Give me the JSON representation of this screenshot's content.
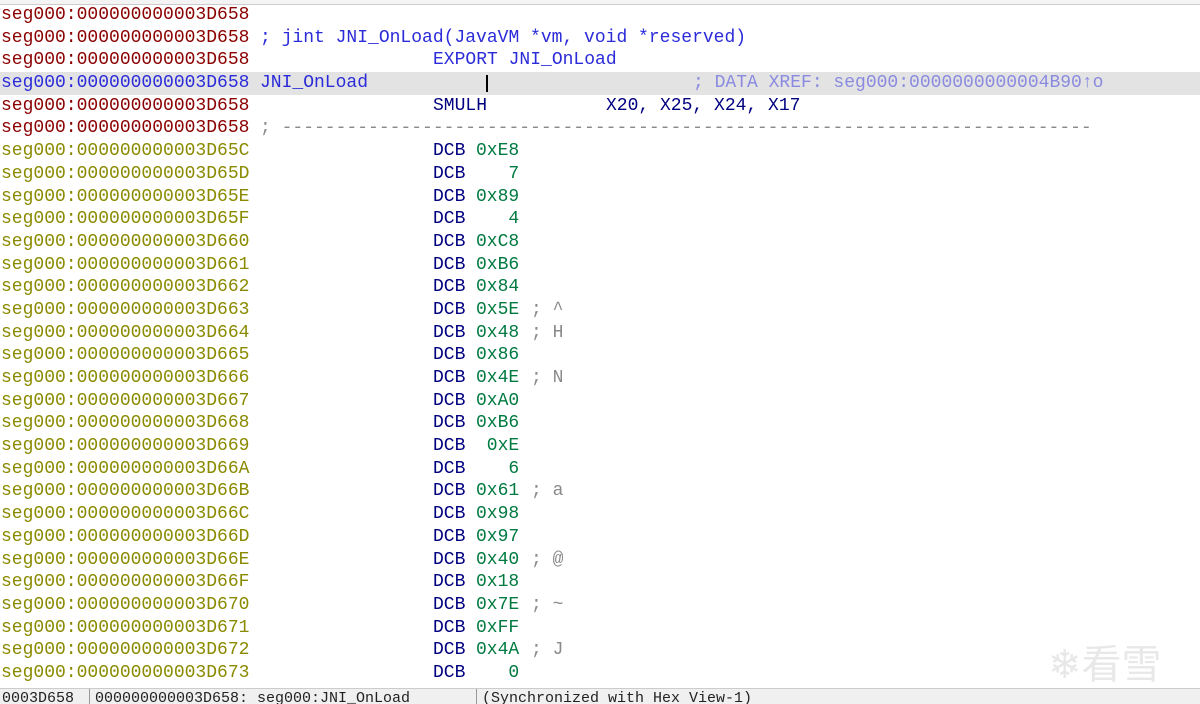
{
  "rows": [
    {
      "addr": "seg000:000000000003D658",
      "kind": "code"
    },
    {
      "addr": "seg000:000000000003D658",
      "kind": "code",
      "comment": "; jint JNI_OnLoad(JavaVM *vm, void *reserved)"
    },
    {
      "addr": "seg000:000000000003D658",
      "kind": "code",
      "mnemonic": "EXPORT JNI_OnLoad"
    },
    {
      "addr": "seg000:000000000003D658",
      "kind": "selected",
      "label": "JNI_OnLoad",
      "xref": "; DATA XREF: seg000:0000000000004B90↑o"
    },
    {
      "addr": "seg000:000000000003D658",
      "kind": "code",
      "mnemonic": "SMULH",
      "operands": "X20, X25, X24, X17"
    },
    {
      "addr": "seg000:000000000003D658",
      "kind": "code",
      "separator": "; ---------------------------------------------------------------------------"
    }
  ],
  "data_rows": [
    {
      "addr": "seg000:000000000003D65C",
      "op": "DCB",
      "val": "0xE8"
    },
    {
      "addr": "seg000:000000000003D65D",
      "op": "DCB",
      "val": "   7"
    },
    {
      "addr": "seg000:000000000003D65E",
      "op": "DCB",
      "val": "0x89"
    },
    {
      "addr": "seg000:000000000003D65F",
      "op": "DCB",
      "val": "   4"
    },
    {
      "addr": "seg000:000000000003D660",
      "op": "DCB",
      "val": "0xC8"
    },
    {
      "addr": "seg000:000000000003D661",
      "op": "DCB",
      "val": "0xB6"
    },
    {
      "addr": "seg000:000000000003D662",
      "op": "DCB",
      "val": "0x84"
    },
    {
      "addr": "seg000:000000000003D663",
      "op": "DCB",
      "val": "0x5E",
      "cmt": "; ^"
    },
    {
      "addr": "seg000:000000000003D664",
      "op": "DCB",
      "val": "0x48",
      "cmt": "; H"
    },
    {
      "addr": "seg000:000000000003D665",
      "op": "DCB",
      "val": "0x86"
    },
    {
      "addr": "seg000:000000000003D666",
      "op": "DCB",
      "val": "0x4E",
      "cmt": "; N"
    },
    {
      "addr": "seg000:000000000003D667",
      "op": "DCB",
      "val": "0xA0"
    },
    {
      "addr": "seg000:000000000003D668",
      "op": "DCB",
      "val": "0xB6"
    },
    {
      "addr": "seg000:000000000003D669",
      "op": "DCB",
      "val": " 0xE"
    },
    {
      "addr": "seg000:000000000003D66A",
      "op": "DCB",
      "val": "   6"
    },
    {
      "addr": "seg000:000000000003D66B",
      "op": "DCB",
      "val": "0x61",
      "cmt": "; a"
    },
    {
      "addr": "seg000:000000000003D66C",
      "op": "DCB",
      "val": "0x98"
    },
    {
      "addr": "seg000:000000000003D66D",
      "op": "DCB",
      "val": "0x97"
    },
    {
      "addr": "seg000:000000000003D66E",
      "op": "DCB",
      "val": "0x40",
      "cmt": "; @"
    },
    {
      "addr": "seg000:000000000003D66F",
      "op": "DCB",
      "val": "0x18"
    },
    {
      "addr": "seg000:000000000003D670",
      "op": "DCB",
      "val": "0x7E",
      "cmt": "; ~"
    },
    {
      "addr": "seg000:000000000003D671",
      "op": "DCB",
      "val": "0xFF"
    },
    {
      "addr": "seg000:000000000003D672",
      "op": "DCB",
      "val": "0x4A",
      "cmt": "; J"
    },
    {
      "addr": "seg000:000000000003D673",
      "op": "DCB",
      "val": "   0"
    }
  ],
  "status": {
    "offset": "0003D658",
    "location": "000000000003D658: seg000:JNI_OnLoad",
    "sync": "(Synchronized with Hex View-1)"
  },
  "watermark": "看雪"
}
